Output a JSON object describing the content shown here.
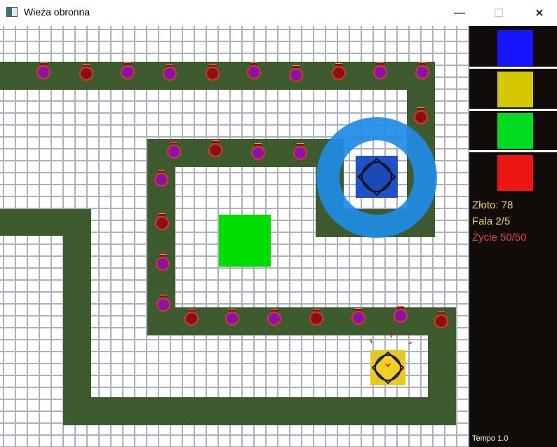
{
  "window": {
    "title": "Wieża obronna",
    "minimize": "—",
    "maximize": "☐",
    "close": "✕"
  },
  "panel": {
    "tower_shop": [
      {
        "name": "blue-tower",
        "color": "#1515ff"
      },
      {
        "name": "yellow-tower",
        "color": "#d4c800"
      },
      {
        "name": "green-tower",
        "color": "#00dd20"
      },
      {
        "name": "red-tower",
        "color": "#ee1515"
      }
    ],
    "gold": "Złoto: 78",
    "wave": "Fala 2/5",
    "lives": "Życie 50/50",
    "tempo": "Tempo  1.0",
    "colors": {
      "gold": "#e6d640",
      "wave": "#e6d640",
      "lives": "#e04848"
    }
  },
  "game": {
    "path_color": "#3e5b2f",
    "enemy_count": 25,
    "towers": [
      {
        "type": "blue",
        "color": "#1e50c8",
        "range_ring": "#2a90e0"
      },
      {
        "type": "yellow",
        "color": "#e6c81e"
      },
      {
        "type": "green",
        "color": "#00dd00"
      }
    ]
  }
}
